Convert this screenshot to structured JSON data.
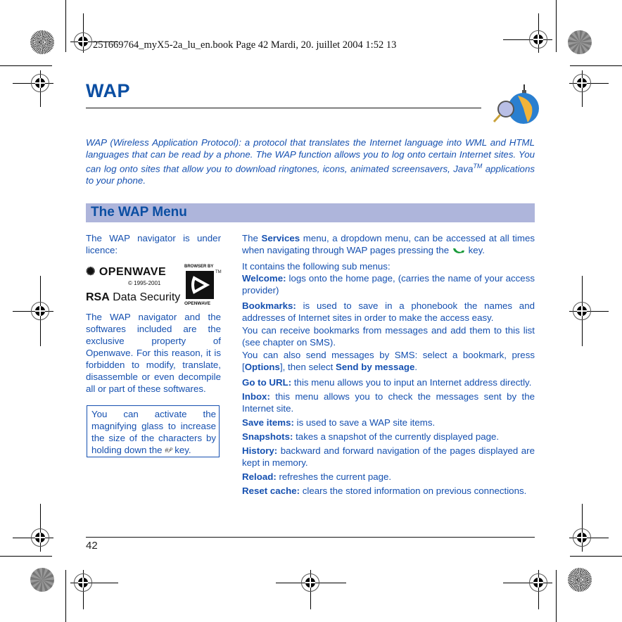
{
  "slug": "251669764_myX5-2a_lu_en.book  Page 42  Mardi, 20. juillet 2004  1:52 13",
  "page": {
    "title": "WAP",
    "icon": "globe-magnifier-icon",
    "intro": {
      "text": "WAP (Wireless Application Protocol): a protocol that translates the Internet language into WML and HTML languages that can be read by a phone. The WAP function allows you to log onto certain Internet sites. You can log onto sites that allow you to download ringtones, icons, animated screensavers, Java",
      "sup": "TM",
      "tail": " applications to your phone."
    },
    "section_title": "The WAP Menu",
    "left": {
      "licence": "The WAP navigator is under licence:",
      "logos": {
        "openwave": "OPENWAVE",
        "copyright": "© 1995-2001",
        "rsa_bold": "RSA",
        "rsa_rest": " Data Security",
        "badge_top": "BROWSER BY",
        "badge_tm": "TM",
        "badge_bottom": "OPENWAVE"
      },
      "property": "The WAP navigator and the softwares included are the exclusive property of Openwave. For this reason, it is forbidden to modify, translate, disassemble or even decompile all or part of these softwares.",
      "tip": {
        "before": "You can activate the magnifying glass to increase the size of the characters by holding down the ",
        "key": "#♪ᴾ",
        "after": " key."
      }
    },
    "right": {
      "services": {
        "pre": "The ",
        "bold": "Services",
        "mid": " menu, a dropdown menu, can be accessed at all times when navigating through WAP pages pressing the ",
        "post": " key."
      },
      "contains": "It contains the following sub menus:",
      "items": [
        {
          "label": "Welcome:",
          "text": " logs onto the home page, (carries the name of your access provider)"
        },
        {
          "label": "Bookmarks:",
          "text": " is used to save in a phonebook the names and addresses of Internet sites in order to make the access easy."
        }
      ],
      "bookmarks_extra1": "You can receive bookmarks from messages and add them to this list (see chapter on SMS).",
      "bookmarks_extra2": {
        "pre": "You can also send messages by SMS: select a bookmark, press [",
        "options": "Options",
        "mid": "], then select ",
        "send": "Send by message",
        "post": "."
      },
      "items2": [
        {
          "label": "Go to URL:",
          "text": " this menu allows you to input an Internet address directly."
        },
        {
          "label": "Inbox:",
          "text": " this menu allows you to check the messages sent by the Internet site."
        },
        {
          "label": "Save items:",
          "text": " is used to save a WAP site items."
        },
        {
          "label": "Snapshots:",
          "text": " takes a snapshot of the currently displayed page."
        },
        {
          "label": "History:",
          "text": " backward and forward navigation of the pages displayed are kept in memory."
        },
        {
          "label": "Reload:",
          "text": " refreshes the current page."
        },
        {
          "label": "Reset cache:",
          "text": " clears the stored information on previous connections."
        }
      ]
    },
    "page_number": "42"
  },
  "colors": {
    "heading": "#0b4ea2",
    "body_text": "#1550b0",
    "banner": "#aeb5db",
    "phone_key": "#1a9a3a"
  }
}
